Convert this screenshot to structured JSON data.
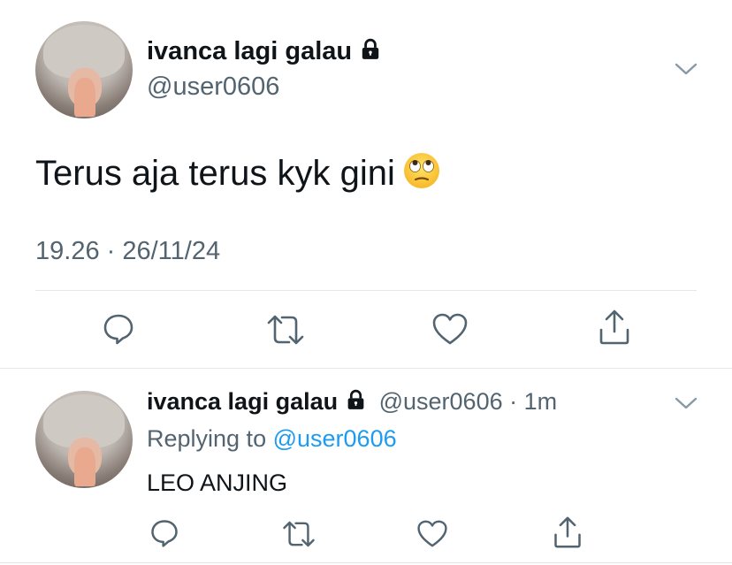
{
  "main_tweet": {
    "display_name": "ivanca lagi galau",
    "handle": "@user0606",
    "text": "Terus aja terus kyk gini",
    "timestamp": "19.26 · 26/11/24"
  },
  "reply": {
    "display_name": "ivanca lagi galau",
    "handle": "@user0606",
    "separator": "·",
    "time": "1m",
    "replying_prefix": "Replying to",
    "replying_to": "@user0606",
    "text": "LEO ANJING"
  },
  "icons": {
    "lock": "lock-icon",
    "more": "chevron-down-icon",
    "reply": "comment-icon",
    "retweet": "retweet-icon",
    "like": "heart-icon",
    "share": "share-icon",
    "emoji": "face-with-rolling-eyes"
  },
  "colors": {
    "text": "#0f1419",
    "secondary": "#536471",
    "link": "#1d9bf0",
    "divider": "#e1e8ed"
  }
}
